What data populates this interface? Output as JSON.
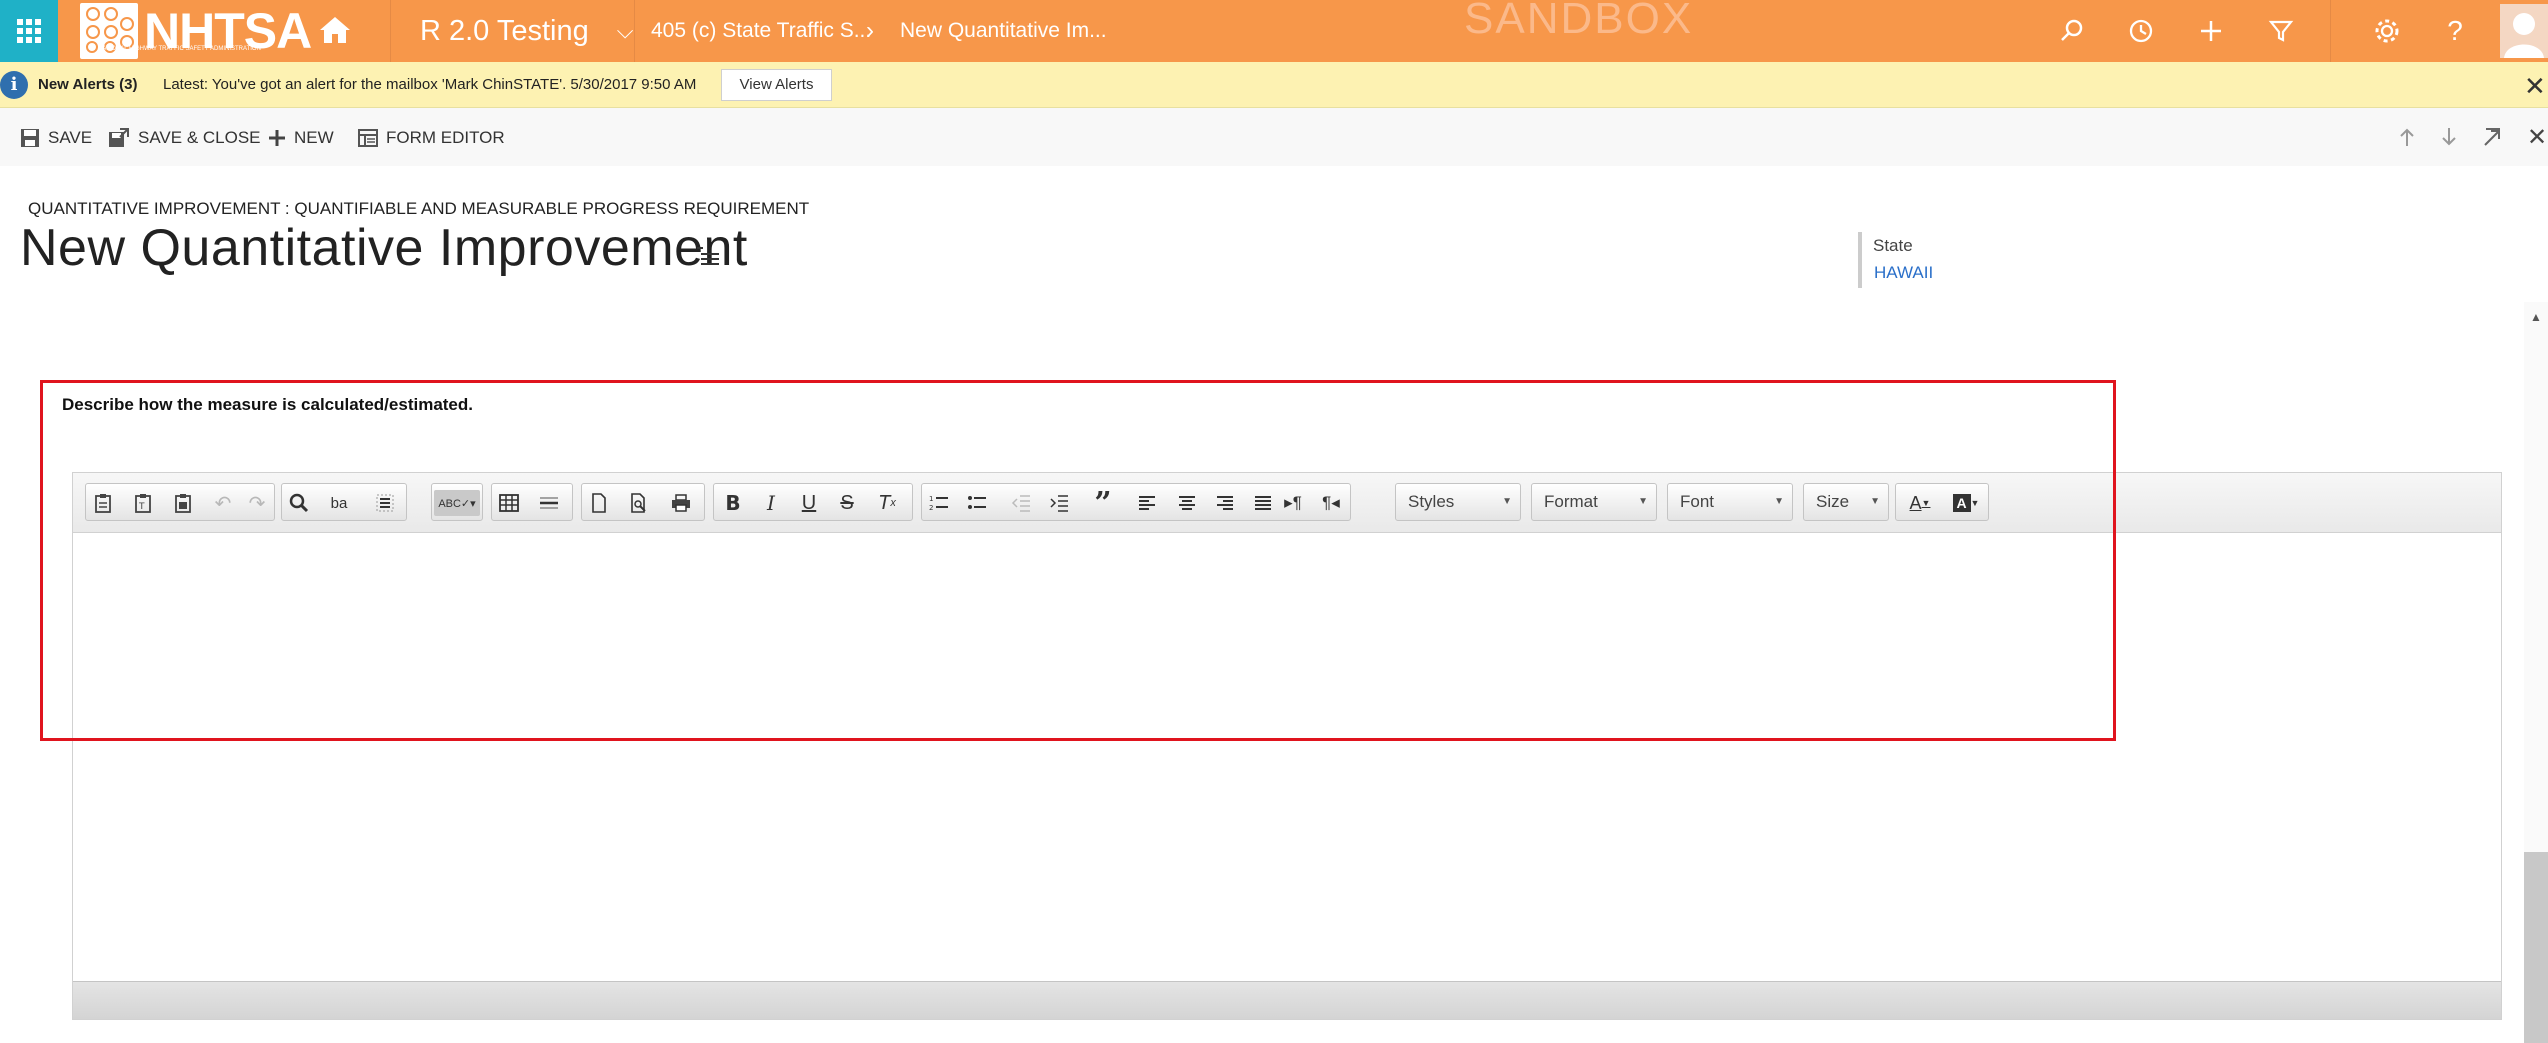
{
  "nav": {
    "logo_text": "NHTSA",
    "logo_subtext": "NATIONAL HIGHWAY TRAFFIC SAFETY ADMINISTRATION",
    "area_label": "R 2.0 Testing",
    "breadcrumb_1": "405 (c) State Traffic S...",
    "breadcrumb_2": "New Quantitative Im...",
    "environment_watermark": "SANDBOX",
    "colors": {
      "bar": "#f7974a",
      "apps": "#1fb1c7"
    }
  },
  "alerts": {
    "title": "New Alerts (3)",
    "message": "Latest: You've got an alert for the mailbox 'Mark ChinSTATE'. 5/30/2017 9:50 AM",
    "button_label": "View Alerts"
  },
  "commands": {
    "save": "SAVE",
    "save_close": "SAVE & CLOSE",
    "new": "NEW",
    "form_editor": "FORM EDITOR"
  },
  "header": {
    "entity_label": "QUANTITATIVE IMPROVEMENT : QUANTIFIABLE AND MEASURABLE PROGRESS REQUIREMENT",
    "title": "New Quantitative Improvement",
    "state_label": "State",
    "state_value": "HAWAII"
  },
  "form": {
    "question": "Describe how the measure is calculated/estimated.",
    "editor_combos": {
      "styles": "Styles",
      "format": "Format",
      "font": "Font",
      "size": "Size"
    },
    "editor_content": ""
  }
}
